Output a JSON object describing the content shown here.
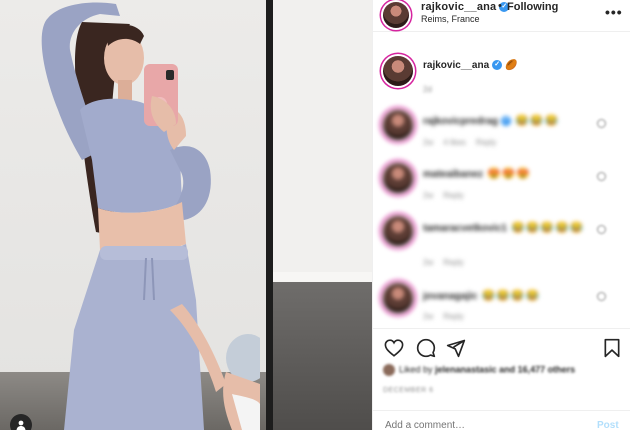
{
  "header": {
    "username": "rajkovic__ana",
    "separator": "•",
    "follow_label": "Following",
    "location": "Reims, France",
    "more_label": "•••"
  },
  "caption": {
    "username": "rajkovic__ana",
    "emoji": "🏉",
    "time": "2d"
  },
  "comments": [
    {
      "username": "rajkovicpredrag",
      "verified": true,
      "text": "😂😂😂",
      "time": "2w",
      "likes": "4 likes",
      "reply": "Reply"
    },
    {
      "username": "mateaibanez",
      "verified": false,
      "text": "😍😍😍",
      "time": "2w",
      "likes": "",
      "reply": "Reply"
    },
    {
      "username": "tamaracvetkovic1",
      "verified": false,
      "text": "😂😂😂😂😂",
      "time": "2w",
      "likes": "",
      "reply": "Reply"
    },
    {
      "username": "jovanagajic",
      "verified": false,
      "text": "😂😂😂😂",
      "time": "2w",
      "likes": "",
      "reply": "Reply"
    }
  ],
  "likes": {
    "prefix": "Liked by",
    "user": "jelenanastasic",
    "suffix": "and 16,477 others"
  },
  "date": "DECEMBER 6",
  "add_comment": {
    "placeholder": "Add a comment…",
    "post_label": "Post"
  },
  "icons": {
    "heart": "heart-icon",
    "comment": "comment-icon",
    "share": "share-icon",
    "save": "bookmark-icon",
    "tag": "user-tag-icon"
  },
  "colors": {
    "verified": "#3897f0",
    "post_disabled": "#b2dffc",
    "story_ring": "#d6249f"
  }
}
